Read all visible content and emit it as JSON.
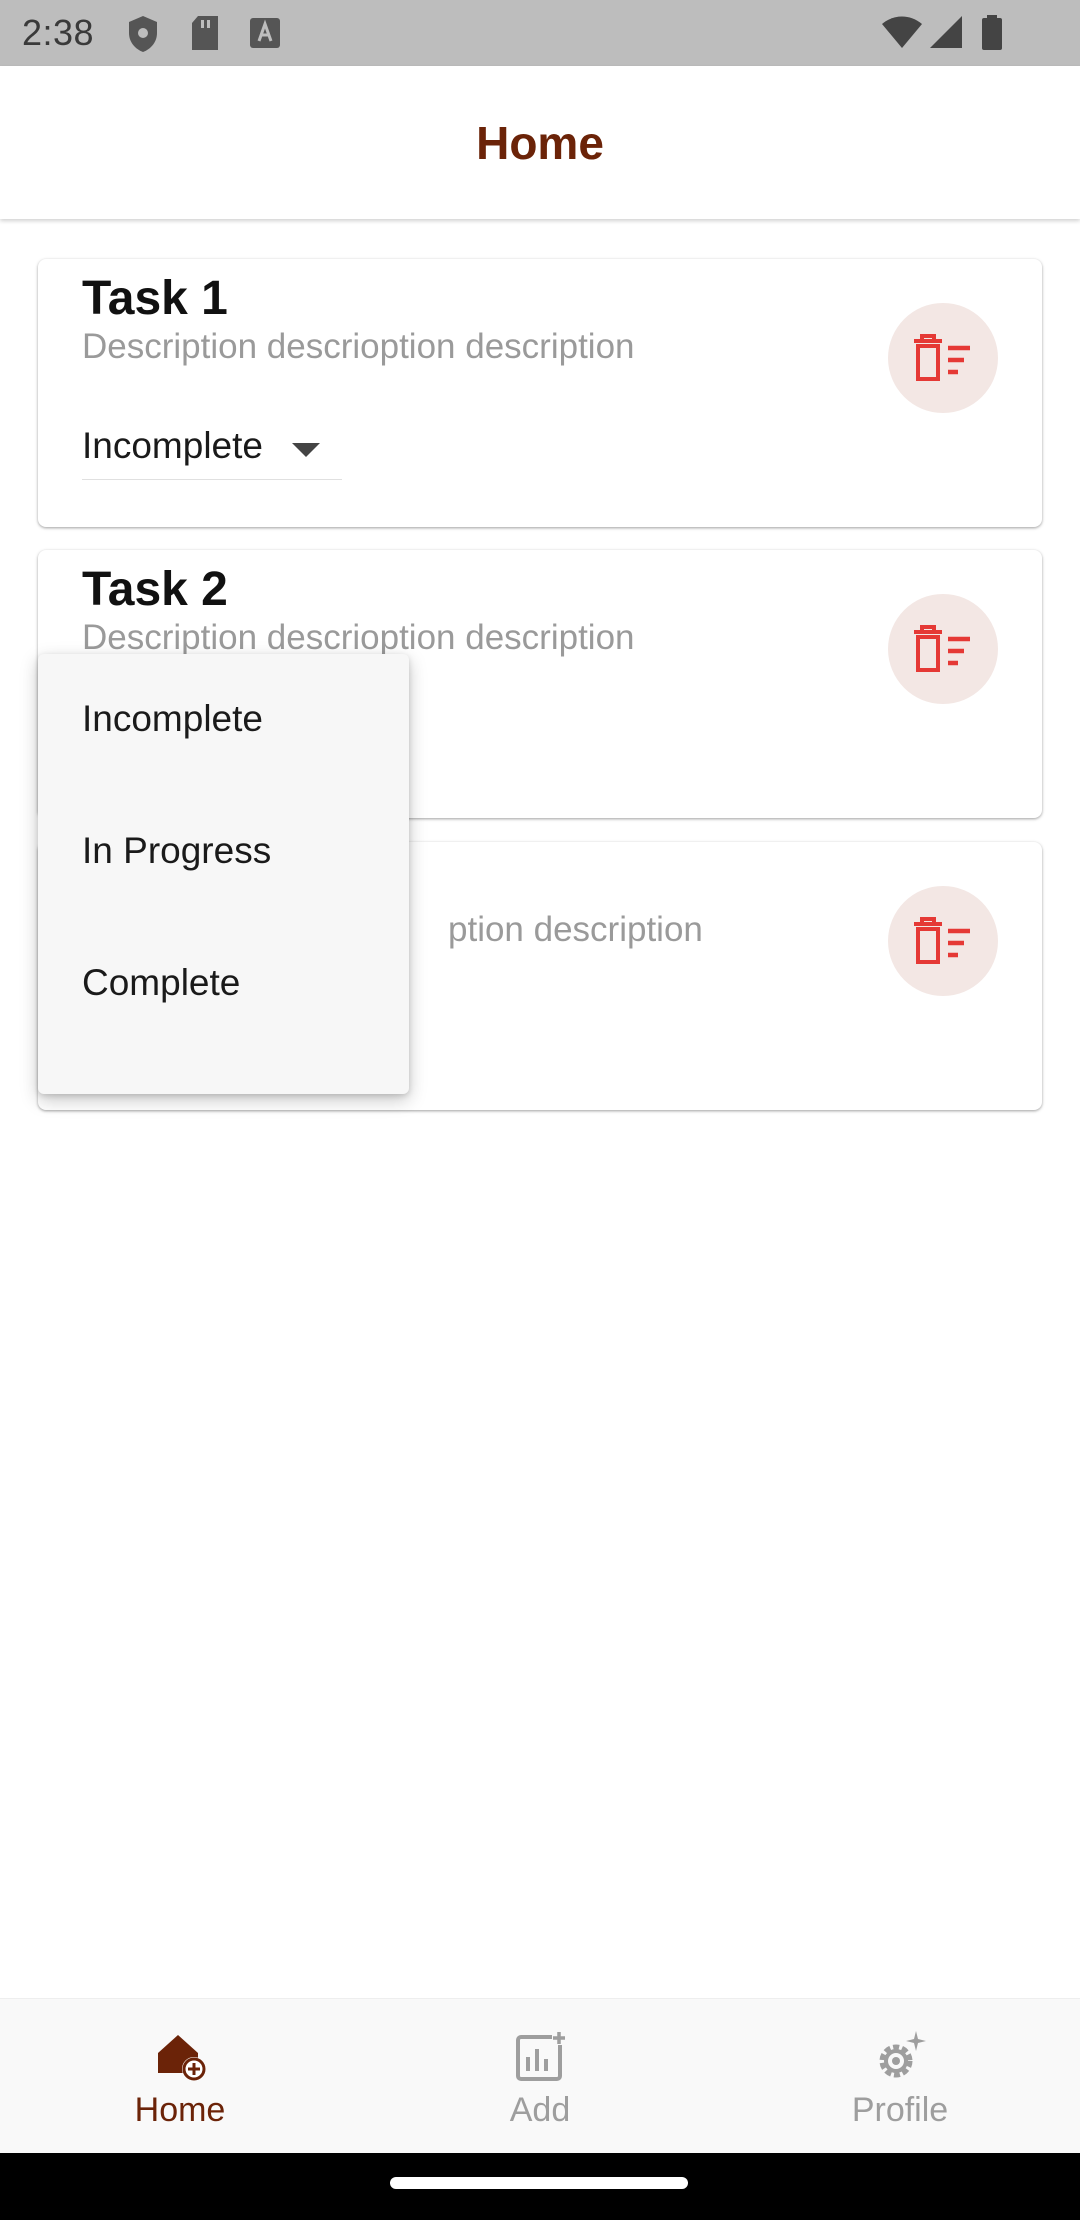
{
  "status_bar": {
    "time": "2:38"
  },
  "app_bar": {
    "title": "Home"
  },
  "tasks": [
    {
      "title": "Task 1",
      "description": "Description descrioption description",
      "status": "Incomplete"
    },
    {
      "title": "Task 2",
      "description": "Description descrioption description"
    },
    {
      "description_partial": "ption description"
    }
  ],
  "dropdown": {
    "options": [
      "Incomplete",
      "In Progress",
      "Complete"
    ]
  },
  "bottom_nav": {
    "items": [
      {
        "label": "Home",
        "icon": "home-add-icon",
        "active": true
      },
      {
        "label": "Add",
        "icon": "chart-add-icon",
        "active": false
      },
      {
        "label": "Profile",
        "icon": "settings-sparkle-icon",
        "active": false
      }
    ]
  },
  "colors": {
    "brand": "#6b2308",
    "delete_icon": "#e53935",
    "delete_bg": "#f3e7e4",
    "inactive_nav": "#9e9e9e"
  }
}
